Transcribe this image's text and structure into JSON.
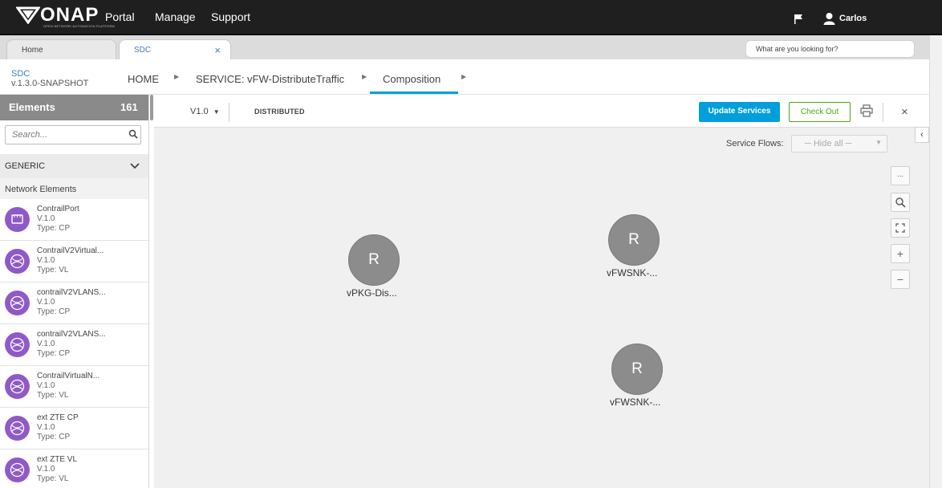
{
  "topbar": {
    "logo_text": "ONAP",
    "logo_tagline": "OPEN NETWORK AUTOMATION PLATFORM",
    "portal_label": "Portal",
    "nav": [
      "Manage",
      "Support"
    ],
    "flag_icon": "flag-icon",
    "user_icon": "user-icon",
    "user_name": "Carlos"
  },
  "tabs": [
    {
      "label": "Home",
      "active": false
    },
    {
      "label": "SDC",
      "active": true,
      "close": "×"
    }
  ],
  "global_search": {
    "placeholder": "What are you looking for?"
  },
  "sdc": {
    "title": "SDC",
    "version": "v.1.3.0-SNAPSHOT",
    "breadcrumb": [
      "HOME",
      "SERVICE: vFW-DistributeTraffic",
      "Composition"
    ]
  },
  "elements": {
    "title": "Elements",
    "count": "161",
    "search_placeholder": "Search...",
    "category": "GENERIC",
    "subcategory": "Network Elements",
    "items": [
      {
        "name": "ContrailPort",
        "version": "V.1.0",
        "type": "Type: CP",
        "icon": "port-icon"
      },
      {
        "name": "ContrailV2Virtual...",
        "version": "V.1.0",
        "type": "Type: VL",
        "icon": "network-icon"
      },
      {
        "name": "contrailV2VLANS...",
        "version": "V.1.0",
        "type": "Type: CP",
        "icon": "network-icon"
      },
      {
        "name": "contrailV2VLANS...",
        "version": "V.1.0",
        "type": "Type: CP",
        "icon": "network-icon"
      },
      {
        "name": "ContrailVirtualN...",
        "version": "V.1.0",
        "type": "Type: VL",
        "icon": "network-icon"
      },
      {
        "name": "ext ZTE CP",
        "version": "V.1.0",
        "type": "Type: CP",
        "icon": "network-icon"
      },
      {
        "name": "ext ZTE VL",
        "version": "V.1.0",
        "type": "Type: VL",
        "icon": "network-icon"
      }
    ]
  },
  "toolbar": {
    "version": "V1.0",
    "state": "DISTRIBUTED",
    "update_label": "Update Services",
    "checkout_label": "Check Out",
    "close": "×"
  },
  "service_flows": {
    "label": "Service Flows:",
    "value": "─ Hide all ─"
  },
  "zoom_controls": [
    "...",
    "search-icon",
    "fit-icon",
    "+",
    "−"
  ],
  "nodes": [
    {
      "letter": "R",
      "label": "vPKG-Dis..."
    },
    {
      "letter": "R",
      "label": "vFWSNK-..."
    },
    {
      "letter": "R",
      "label": "vFWSNK-..."
    }
  ],
  "colors": {
    "accent": "#009fdb",
    "checkout": "#4ca90c",
    "element_icon": "#8f5ac7",
    "node": "#8c8c8c"
  }
}
